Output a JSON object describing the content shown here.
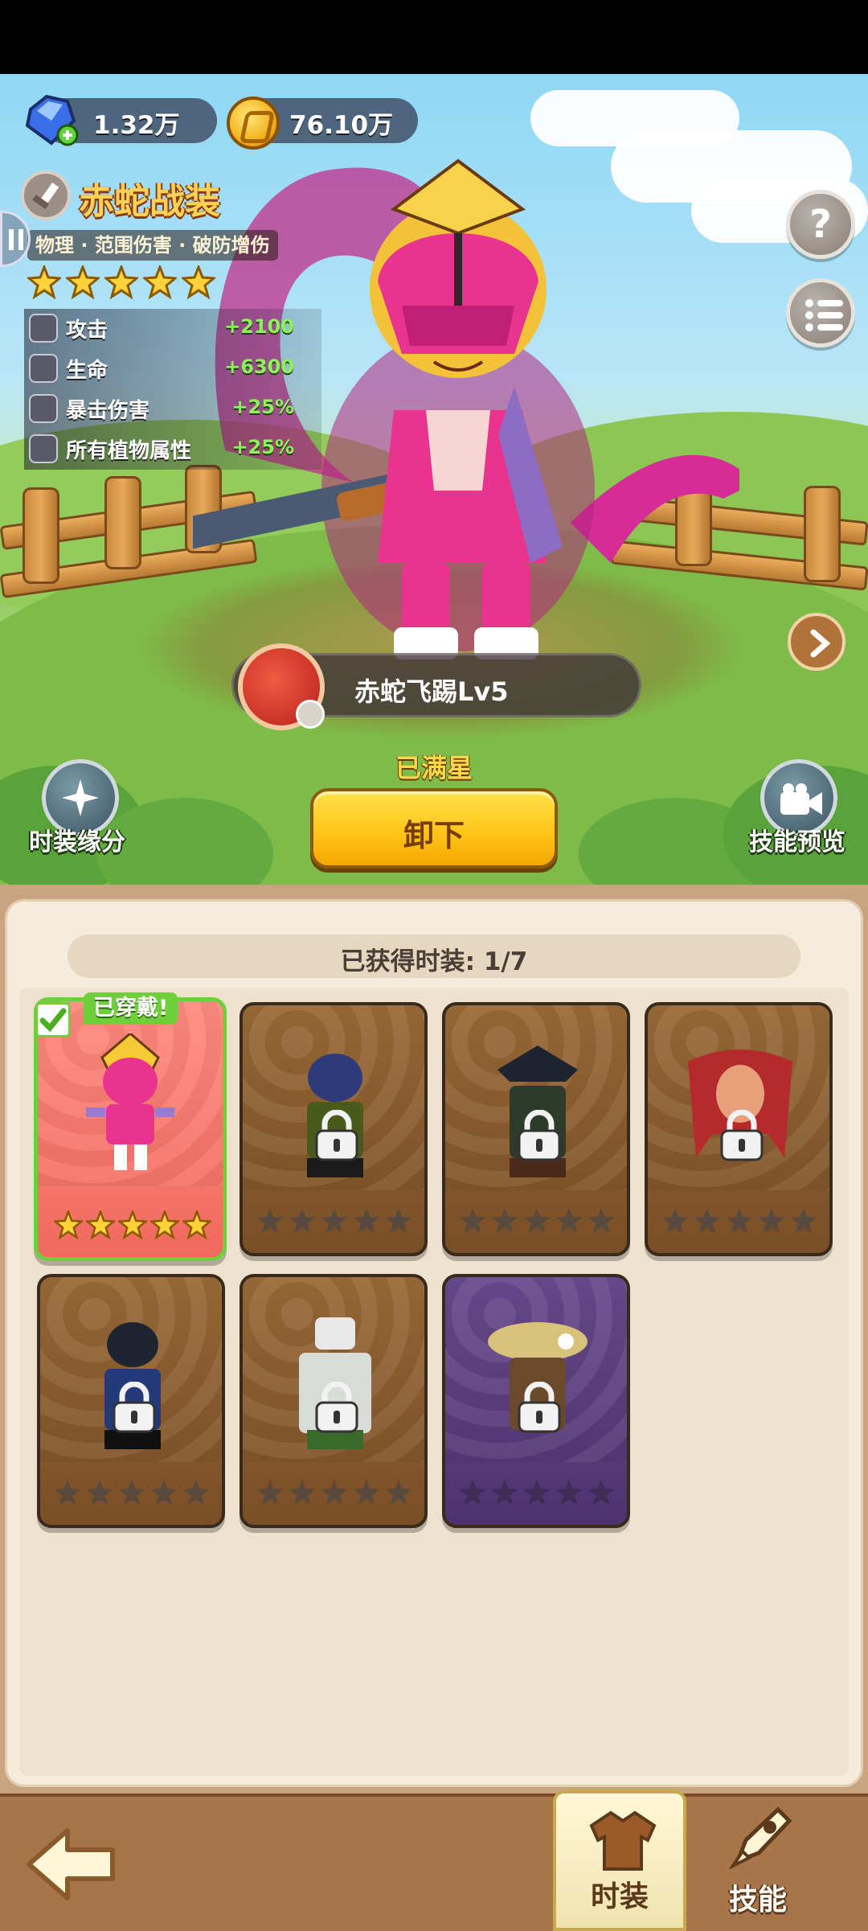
{
  "currency": {
    "gems": "1.32万",
    "coins": "76.10万"
  },
  "costume": {
    "name": "赤蛇战装",
    "tags": "物理 · 范围伤害 · 破防增伤",
    "stars": 5,
    "stats": [
      {
        "name": "攻击",
        "value": "+2100"
      },
      {
        "name": "生命",
        "value": "+6300"
      },
      {
        "name": "暴击伤害",
        "value": "+25%"
      },
      {
        "name": "所有植物属性",
        "value": "+25%"
      }
    ]
  },
  "skill": {
    "label": "赤蛇飞踢Lv5"
  },
  "status": {
    "max_star": "已满星"
  },
  "buttons": {
    "unequip": "卸下",
    "costume_bond": "时装缘分",
    "skill_preview": "技能预览",
    "help": "?",
    "menu": "list"
  },
  "collection": {
    "count_label": "已获得时装: 1/7",
    "worn_badge": "已穿戴!",
    "cards": [
      {
        "state": "owned",
        "stars_filled": 5,
        "color": "red"
      },
      {
        "state": "locked",
        "stars_filled": 0,
        "color": "brown"
      },
      {
        "state": "locked",
        "stars_filled": 0,
        "color": "brown"
      },
      {
        "state": "locked",
        "stars_filled": 0,
        "color": "brown"
      },
      {
        "state": "locked",
        "stars_filled": 0,
        "color": "brown"
      },
      {
        "state": "locked",
        "stars_filled": 0,
        "color": "brown"
      },
      {
        "state": "locked",
        "stars_filled": 0,
        "color": "purple"
      }
    ]
  },
  "nav": {
    "costume_tab": "时装",
    "skill_tab": "技能"
  },
  "colors": {
    "gold_text": "#ffd257",
    "stat_green": "#8cf25a",
    "button_yellow": "#ffc61a",
    "owned_green": "#6fcf3a"
  }
}
